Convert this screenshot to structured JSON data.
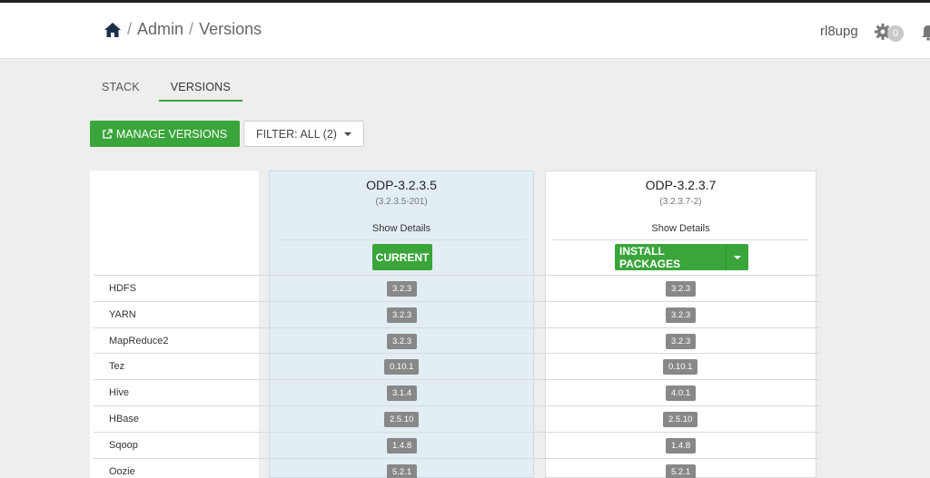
{
  "header": {
    "breadcrumbs": [
      "Admin",
      "Versions"
    ],
    "separator": "/",
    "username": "rl8upg",
    "ops_count": "0"
  },
  "tabs": [
    {
      "label": "STACK",
      "active": false
    },
    {
      "label": "VERSIONS",
      "active": true
    }
  ],
  "toolbar": {
    "manage_label": "MANAGE VERSIONS",
    "filter_label": "FILTER: ALL (2)"
  },
  "versions": [
    {
      "name": "ODP-3.2.3.5",
      "build": "(3.2.3.5-201)",
      "details": "Show Details",
      "action": "CURRENT"
    },
    {
      "name": "ODP-3.2.3.7",
      "build": "(3.2.3.7-2)",
      "details": "Show Details",
      "action": "INSTALL PACKAGES"
    }
  ],
  "services": [
    {
      "name": "HDFS",
      "v1": "3.2.3",
      "v2": "3.2.3"
    },
    {
      "name": "YARN",
      "v1": "3.2.3",
      "v2": "3.2.3"
    },
    {
      "name": "MapReduce2",
      "v1": "3.2.3",
      "v2": "3.2.3"
    },
    {
      "name": "Tez",
      "v1": "0.10.1",
      "v2": "0.10.1"
    },
    {
      "name": "Hive",
      "v1": "3.1.4",
      "v2": "4.0.1"
    },
    {
      "name": "HBase",
      "v1": "2.5.10",
      "v2": "2.5.10"
    },
    {
      "name": "Sqoop",
      "v1": "1.4.8",
      "v2": "1.4.8"
    },
    {
      "name": "Oozie",
      "v1": "5.2.1",
      "v2": "5.2.1"
    }
  ],
  "colors": {
    "accent": "#3aa53a",
    "current_bg": "#e2eef4",
    "badge": "#888888"
  }
}
